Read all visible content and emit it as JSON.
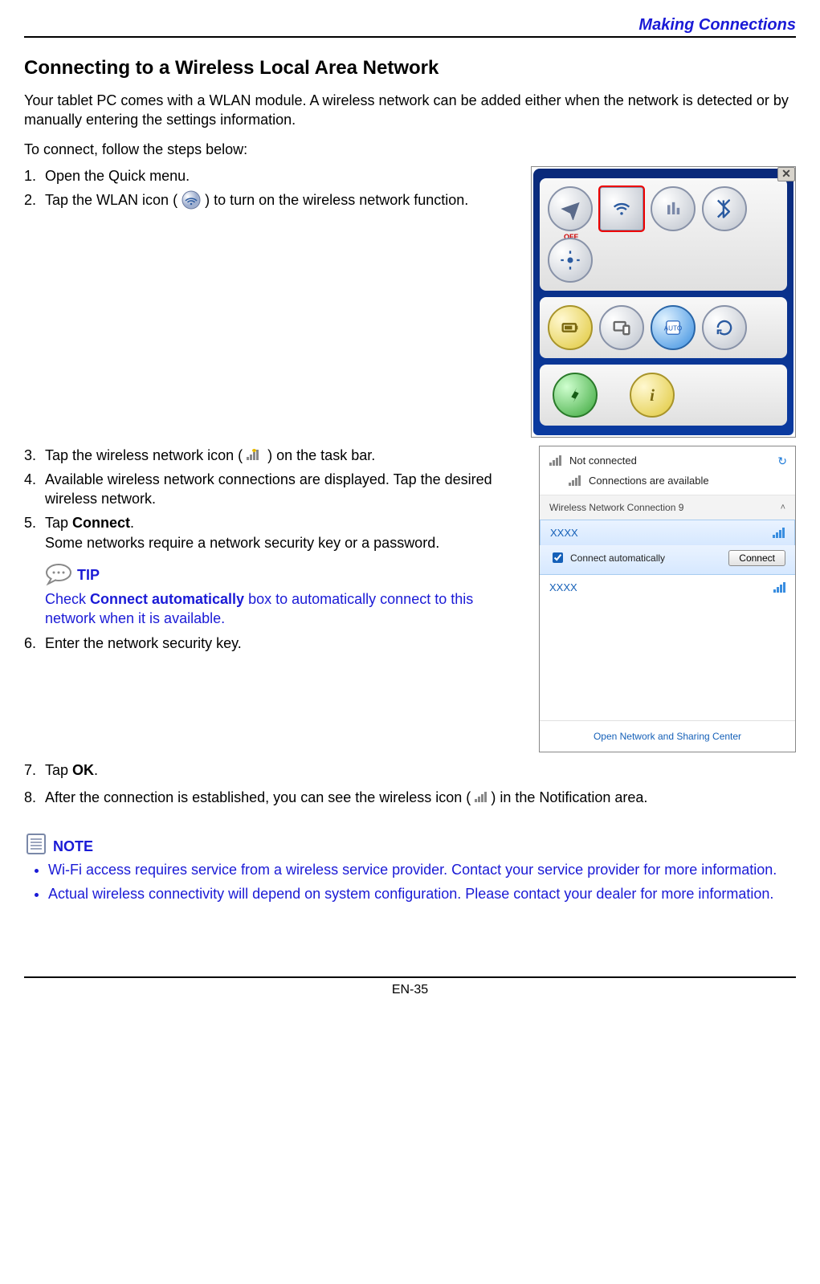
{
  "header": {
    "breadcrumb": "Making Connections"
  },
  "title": "Connecting to a Wireless Local Area Network",
  "intro": "Your tablet PC comes with a WLAN module. A wireless network can be added either when the network is detected or by manually entering the settings information.",
  "lead": "To connect, follow the steps below:",
  "steps": {
    "s1": "Open the Quick menu.",
    "s2a": "Tap the WLAN icon (",
    "s2b": ") to turn on the wireless network function.",
    "s3a": "Tap the wireless network icon (",
    "s3b": ") on the task bar.",
    "s4": "Available wireless network connections are displayed. Tap the desired wireless network.",
    "s5a": "Tap ",
    "s5b": "Connect",
    "s5c": ".",
    "s5d": "Some networks require a network security key or a password.",
    "s6": "Enter the network security key.",
    "s7a": "Tap ",
    "s7b": "OK",
    "s7c": ".",
    "s8a": "After the connection is established, you can see the wireless icon (",
    "s8b": ") in the Notification area."
  },
  "tip": {
    "label": "TIP",
    "t1": "Check ",
    "t2": "Connect automatically",
    "t3": " box to automatically connect to this network when it is available."
  },
  "note": {
    "label": "NOTE",
    "n1": "Wi-Fi access requires service from a wireless service provider. Contact your service provider for more information.",
    "n2": "Actual wireless connectivity will depend on system configuration. Please contact your dealer for more information."
  },
  "quickmenu": {
    "off_label": "OFF",
    "icons": [
      "airplane",
      "wlan",
      "wwan",
      "bluetooth",
      "gps",
      "battery",
      "devices",
      "auto",
      "rotate",
      "settings",
      "info"
    ]
  },
  "wifi": {
    "status": "Not connected",
    "avail": "Connections are available",
    "section": "Wireless Network Connection 9",
    "net1": "XXXX",
    "auto": "Connect automatically",
    "connect_btn": "Connect",
    "net2": "XXXX",
    "foot": "Open Network and Sharing Center"
  },
  "footer": "EN-35"
}
